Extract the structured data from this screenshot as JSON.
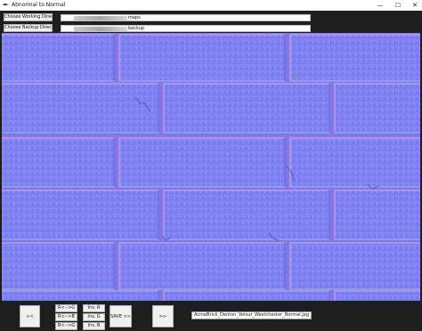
{
  "window": {
    "title": "Abnormal to Normal",
    "minimize": "—",
    "maximize": "☐",
    "close": "✕"
  },
  "toolbar": {
    "working_dir_button": "Choose Working Directory",
    "working_dir_path": "maps",
    "backup_dir_button": "Choose Backup Directory",
    "backup_dir_path": "backup"
  },
  "viewer": {
    "image_label": "normal-map brick texture"
  },
  "controls": {
    "prev_label": "<<",
    "swap_rg": "R<-->G",
    "swap_rb": "R<-->B",
    "swap_bg": "B<-->G",
    "inv_r": "Inv. R",
    "inv_g": "Inv. G",
    "inv_b": "Inv. B",
    "save_next": "SAVE >>",
    "next_label": ">>",
    "filename": "AcmeBrick_Denton_Velour_Westchester_Normal.jpg"
  },
  "colors": {
    "base": "#7d7ef2",
    "highlight": "#c7a6f0",
    "shadow": "#5e6ff0",
    "groove": "#8f77e3"
  }
}
